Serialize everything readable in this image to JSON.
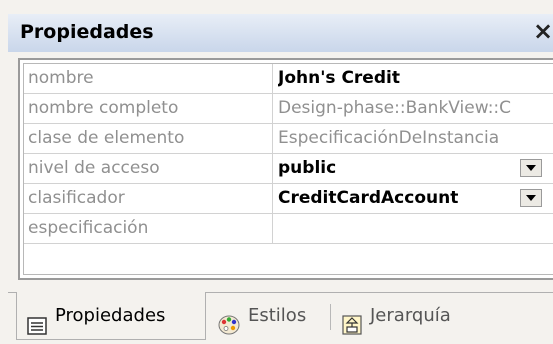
{
  "panel": {
    "title": "Propiedades",
    "close_label": "×"
  },
  "properties": [
    {
      "label": "nombre",
      "value": "John's Credit",
      "style": "bold",
      "dropdown": false
    },
    {
      "label": "nombre completo",
      "value": "Design-phase::BankView::C",
      "style": "gray",
      "dropdown": false
    },
    {
      "label": "clase de elemento",
      "value": "EspecificaciónDeInstancia",
      "style": "gray",
      "dropdown": false
    },
    {
      "label": "nivel de acceso",
      "value": "public",
      "style": "bold",
      "dropdown": true
    },
    {
      "label": "clasificador",
      "value": "CreditCardAccount",
      "style": "bold",
      "dropdown": true
    },
    {
      "label": "especificación",
      "value": "",
      "style": "gray",
      "dropdown": false
    }
  ],
  "tabs": [
    {
      "label": "Propiedades",
      "icon": "properties-list-icon",
      "active": true
    },
    {
      "label": "Estilos",
      "icon": "palette-icon",
      "active": false
    },
    {
      "label": "Jerarquía",
      "icon": "hierarchy-icon",
      "active": false
    }
  ],
  "colors": {
    "title_bar_top": "#e8eef7",
    "title_bar_bottom": "#c9d6ea",
    "label_text": "#909090",
    "panel_bg": "#f4f2ee"
  }
}
